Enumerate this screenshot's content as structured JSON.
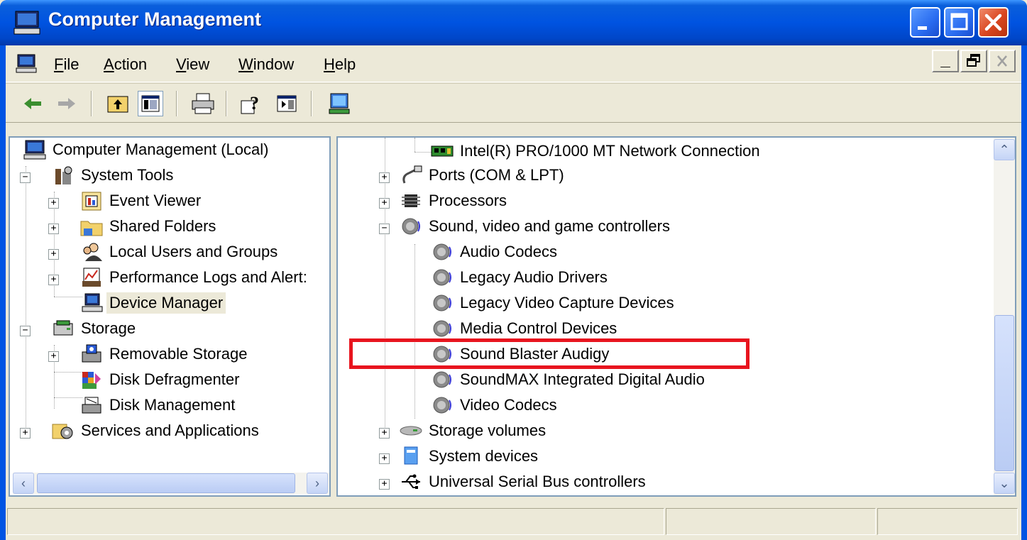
{
  "window": {
    "title": "Computer Management"
  },
  "menu": {
    "items": [
      {
        "label": "File",
        "accel": "F"
      },
      {
        "label": "Action",
        "accel": "A"
      },
      {
        "label": "View",
        "accel": "V"
      },
      {
        "label": "Window",
        "accel": "W"
      },
      {
        "label": "Help",
        "accel": "H"
      }
    ]
  },
  "toolbar": {
    "buttons": [
      "back-arrow-icon",
      "forward-arrow-icon",
      "up-folder-icon",
      "show-hide-tree-icon",
      "print-icon",
      "help-icon",
      "action-pane-icon",
      "computer-properties-icon"
    ]
  },
  "tree": {
    "root": "Computer Management (Local)",
    "system_tools": "System Tools",
    "event_viewer": "Event Viewer",
    "shared_folders": "Shared Folders",
    "local_users": "Local Users and Groups",
    "perf_logs": "Performance Logs and Alert:",
    "device_manager": "Device Manager",
    "storage": "Storage",
    "removable_storage": "Removable Storage",
    "disk_defrag": "Disk Defragmenter",
    "disk_mgmt": "Disk Management",
    "services": "Services and Applications"
  },
  "devices": {
    "network_adapter": "Intel(R) PRO/1000 MT Network Connection",
    "ports": "Ports (COM & LPT)",
    "processors": "Processors",
    "sound": "Sound, video and game controllers",
    "audio_codecs": "Audio Codecs",
    "legacy_audio": "Legacy Audio Drivers",
    "legacy_video": "Legacy Video Capture Devices",
    "media_control": "Media Control Devices",
    "sound_blaster": "Sound Blaster Audigy",
    "soundmax": "SoundMAX Integrated Digital Audio",
    "video_codecs": "Video Codecs",
    "storage_volumes": "Storage volumes",
    "system_devices": "System devices",
    "usb": "Universal Serial Bus controllers"
  },
  "colors": {
    "titlebar": "#0054E3",
    "highlight_box": "#E8141E",
    "pane_border": "#7F9DB9",
    "face": "#ECE9D8"
  }
}
